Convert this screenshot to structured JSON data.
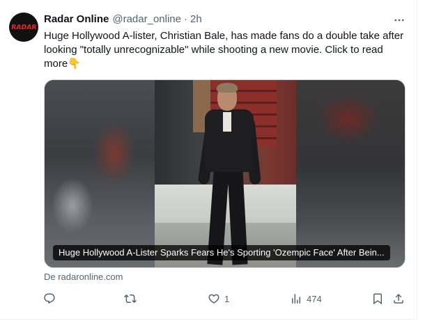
{
  "tweet": {
    "avatar_text": "RADAR",
    "display_name": "Radar Online",
    "handle": "@radar_online",
    "separator": "·",
    "time": "2h",
    "text": "Huge Hollywood A-lister, Christian Bale, has made fans do a double take after looking \"totally unrecognizable\" while shooting a new movie. Click to read more",
    "emoji": "👇",
    "card": {
      "caption": "Huge Hollywood A-Lister Sparks Fears He's Sporting 'Ozempic Face' After Bein...",
      "domain": "De radaronline.com"
    },
    "actions": {
      "reply_icon": "reply-icon",
      "retweet_icon": "retweet-icon",
      "like_icon": "heart-icon",
      "like_count": "1",
      "views_icon": "views-icon",
      "views_count": "474",
      "bookmark_icon": "bookmark-icon",
      "share_icon": "share-icon"
    },
    "more_icon": "more-horizontal-icon"
  },
  "colors": {
    "text_primary": "#0f1419",
    "text_secondary": "#536471",
    "border": "#cfd9de",
    "brand_red": "#e4262b"
  }
}
